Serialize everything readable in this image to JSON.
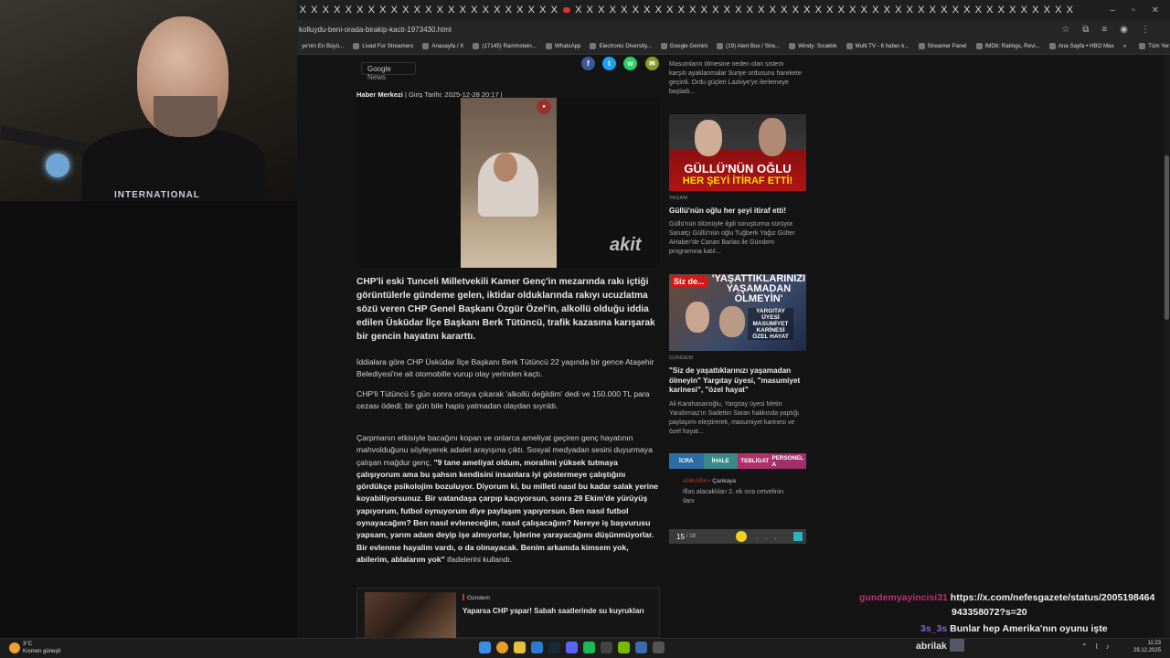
{
  "browser": {
    "url": "kolluydu-beni-orada-birakip-kacti-1973430.html",
    "tab_close_glyph": "X",
    "bookmarks": [
      "ye'nin En Büyü...",
      "Livad For Streamers",
      "Anasayfa / X",
      "(17145) Rammstein...",
      "WhatsApp",
      "Electronic Diversity...",
      "Google Gemini",
      "(19) Alert Box / Stre...",
      "Windy: Sıcaklık",
      "Multi TV - 6 haber k...",
      "Streamer Panel",
      "IMDb: Ratings, Revi...",
      "Ana Sayfa • HBO Max",
      "»",
      "Tüm Yer İşaretleri"
    ]
  },
  "article": {
    "google_news_prefix": "Google",
    "google_news_suffix": "News",
    "author": "Haber Merkezi",
    "date": "| Giriş Tarihi: 2025-12-28 20:17 |",
    "video_logo": "akit",
    "lead": "CHP'li eski Tunceli Milletvekili Kamer Genç'in mezarında rakı içtiği görüntülerle gündeme gelen, iktidar olduklarında rakıyı ucuzlatma sözü veren CHP Genel Başkanı Özgür Özel'in, alkollü olduğu iddia edilen Üsküdar İlçe Başkanı Berk Tütüncü, trafik kazasına karışarak bir gencin hayatını kararttı.",
    "p1": "İddialara göre CHP Üsküdar İlçe Başkanı Berk Tütüncü 22 yaşında bir gence Ataşehir Belediyesi'ne ait otomobille vurup olay yerinden kaçtı.",
    "p2": "CHP'li Tütüncü 5 gün sonra ortaya çıkarak 'alkollü değildim' dedi ve 150.000 TL para cezası ödedi; bir gün bile hapis yatmadan olaydan sıyrıldı.",
    "p3_intro": "Çarpmanın etkisiyle bacağını kopan ve onlarca ameliyat geçiren genç hayatının mahvolduğunu söyleyerek adalet arayışına çıktı. Sosyal medyadan sesini duyurmaya çalışan mağdur genç, ",
    "p3_quote": "\"9 tane ameliyat oldum, moralimi yüksek tutmaya çalışıyorum ama bu şahsın kendisini insanlara iyi göstermeye çalıştığını gördükçe psikolojim bozuluyor. Diyorum ki, bu milleti nasıl bu kadar salak yerine koyabiliyorsunuz. Bir vatandaşa çarpıp kaçıyorsun, sonra 29 Ekim'de yürüyüş yapıyorum, futbol oynuyorum diye paylaşım yapıyorsun. Ben nasıl futbol oynayacağım? Ben nasıl evleneceğim, nasıl çalışacağım? Nereye iş başvurusu yapsam, yarım adam deyip işe almıyorlar, İşlerine yarayacağımı düşünmüyorlar. Bir evlenme hayalim vardı, o da olmayacak. Benim arkamda kimsem yok, abilerim, ablalarım yok\"",
    "p3_outro": " ifadelerini kullandı.",
    "related_category": "Gündem",
    "related_title": "Yaparsa CHP yapar! Sabah saatlerinde su kuyrukları"
  },
  "sidebar": {
    "top_text": "Masumların ölmesine neden olan sistem karşıtı ayaklanmalar Suriye ordusunu harekete geçirdi. Ordu güçleri Lazkiye'ye ilerlemeye başladı...",
    "story1": {
      "img_caption_1": "GÜLLÜ'NÜN OĞLU",
      "img_caption_2": "HER ŞEYİ İTİRAF ETTİ!",
      "category": "YAŞAM",
      "title": "Güllü'nün oğlu her şeyi itiraf etti!",
      "text": "Güllü'nün ölümüyle ilgili soruşturma sürüyor. Sanatçı Güllü'nün oğlu Tuğberk Yağız Gülter AHaber'de Canan Barlas ile Gündem programına katıl..."
    },
    "story2": {
      "img_badge": "Siz de...",
      "img_caption": "'YAŞATTIKLARINIZI YAŞAMADAN ÖLMEYİN'",
      "img_caption_2": "YARGITAY ÜYESİ MASUMİYET KARİNESİ ÖZEL HAYAT",
      "category": "GÜNDEM",
      "title": "\"Siz de yaşattıklarınızı yaşamadan ölmeyin\" Yargıtay üyesi, \"masumiyet karinesi\", \"özel hayat\"",
      "text": "Ali Karahasanoğlu, Yargıtay üyesi Metin Yandırmaz'ın Sadettin Saran hakkında yaptığı paylaşımı eleştirerek, masumiyet karinesi ve özel hayat..."
    },
    "ilan_tabs": [
      "İCRA",
      "İHALE",
      "TEBLİGAT",
      "PERSONEL A"
    ],
    "ilan_tab_colors": [
      "#2e6da4",
      "#3a8a8a",
      "#b0306a",
      "#a0306a"
    ],
    "ilan_city": "ANKARA •",
    "ilan_district": "Çankaya",
    "ilan_text": "İflas alacaklıları 2. ek sıra cetvelinin ilanı",
    "pager_current": "15",
    "pager_total": "/ 18",
    "pager_dots": "..."
  },
  "chat": [
    {
      "user": "gundemyayincisi31",
      "msg": "https://x.com/nefesgazete/status/2005198464",
      "msg2": "943358072?s=20",
      "color": "#c0306a"
    },
    {
      "user": "3s_3s",
      "msg": "Bunlar hep Amerika'nın oyunu işte",
      "color": "#8a5fd0"
    },
    {
      "user": "abrilak",
      "msg": "",
      "color": "#e0e0e0"
    }
  ],
  "webcam": {
    "shirt_text": "INTERNATIONAL"
  },
  "taskbar": {
    "weather_temp": "3°C",
    "weather_desc": "Kısmen güneşli",
    "time": "11:23",
    "date": "29.12.2025",
    "apps": [
      "windows-start",
      "chrome",
      "file-explorer",
      "edge",
      "steam",
      "discord",
      "spotify",
      "calculator",
      "nvidia",
      "app",
      "obs"
    ],
    "app_colors": [
      "#3a8ee8",
      "#e8a020",
      "#e8c040",
      "#2a7ad0",
      "#1b2838",
      "#5865f2",
      "#1db954",
      "#444",
      "#76b900",
      "#3a6ab0",
      "#555"
    ]
  }
}
